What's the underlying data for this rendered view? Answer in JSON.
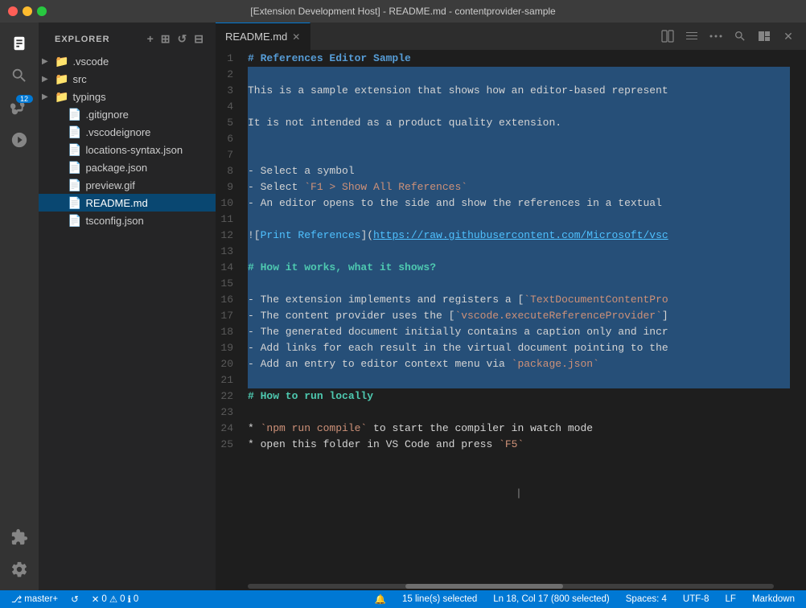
{
  "titlebar": {
    "title": "[Extension Development Host] - README.md - contentprovider-sample"
  },
  "activity_bar": {
    "icons": [
      {
        "name": "files-icon",
        "symbol": "⧉",
        "active": true,
        "badge": false
      },
      {
        "name": "search-icon",
        "symbol": "🔍",
        "active": false,
        "badge": false
      },
      {
        "name": "git-icon",
        "symbol": "⎇",
        "active": false,
        "badge": true,
        "badge_count": "12"
      },
      {
        "name": "debug-icon",
        "symbol": "⬤",
        "active": false,
        "badge": false
      }
    ],
    "bottom_icons": [
      {
        "name": "extensions-icon",
        "symbol": "⊞"
      },
      {
        "name": "settings-icon",
        "symbol": "⚙"
      }
    ]
  },
  "sidebar": {
    "header": "Explorer",
    "toolbar_icons": [
      "new-file",
      "new-folder",
      "refresh",
      "collapse"
    ],
    "files": [
      {
        "label": ".vscode",
        "type": "dir",
        "indent": 0,
        "expanded": false
      },
      {
        "label": "src",
        "type": "dir",
        "indent": 0,
        "expanded": false
      },
      {
        "label": "typings",
        "type": "dir",
        "indent": 0,
        "expanded": false
      },
      {
        "label": ".gitignore",
        "type": "file",
        "indent": 1
      },
      {
        "label": ".vscodeignore",
        "type": "file",
        "indent": 1
      },
      {
        "label": "locations-syntax.json",
        "type": "file",
        "indent": 1
      },
      {
        "label": "package.json",
        "type": "file",
        "indent": 1
      },
      {
        "label": "preview.gif",
        "type": "file",
        "indent": 1
      },
      {
        "label": "README.md",
        "type": "file",
        "indent": 1,
        "selected": true
      },
      {
        "label": "tsconfig.json",
        "type": "file",
        "indent": 1
      }
    ]
  },
  "editor": {
    "tab_label": "README.md",
    "lines": [
      {
        "num": 1,
        "content": "# References Editor Sample",
        "type": "h1"
      },
      {
        "num": 2,
        "content": "",
        "type": "empty"
      },
      {
        "num": 3,
        "content": "This is a sample extension that shows how an editor-based represent",
        "type": "text-selected"
      },
      {
        "num": 4,
        "content": "",
        "type": "selected"
      },
      {
        "num": 5,
        "content": "It is not intended as a product quality extension.",
        "type": "text-selected"
      },
      {
        "num": 6,
        "content": "",
        "type": "selected"
      },
      {
        "num": 7,
        "content": "",
        "type": "selected"
      },
      {
        "num": 8,
        "content": "- Select a symbol",
        "type": "text-selected"
      },
      {
        "num": 9,
        "content": "- Select `F1 > Show All References`",
        "type": "text-selected"
      },
      {
        "num": 10,
        "content": "- An editor opens to the side and show the references in a textual",
        "type": "text-selected"
      },
      {
        "num": 11,
        "content": "",
        "type": "selected"
      },
      {
        "num": 12,
        "content": "![Print References](https://raw.githubusercontent.com/Microsoft/vsc",
        "type": "text-selected"
      },
      {
        "num": 13,
        "content": "",
        "type": "selected"
      },
      {
        "num": 14,
        "content": "# How it works, what it shows?",
        "type": "h2-selected"
      },
      {
        "num": 15,
        "content": "",
        "type": "selected"
      },
      {
        "num": 16,
        "content": "- The extension implements and registers a [`TextDocumentContentPro",
        "type": "text-selected"
      },
      {
        "num": 17,
        "content": "- The content provider uses the [`vscode.executeReferenceProvider`]",
        "type": "text-selected"
      },
      {
        "num": 18,
        "content": "- The generated document initially contains a caption only and incr",
        "type": "text-selected"
      },
      {
        "num": 19,
        "content": "- Add links for each result in the virtual document pointing to the",
        "type": "text-selected"
      },
      {
        "num": 20,
        "content": "- Add an entry to editor context menu via `package.json`",
        "type": "text-selected"
      },
      {
        "num": 21,
        "content": "",
        "type": "selected"
      },
      {
        "num": 22,
        "content": "# How to run locally",
        "type": "h3"
      },
      {
        "num": 23,
        "content": "",
        "type": "empty"
      },
      {
        "num": 24,
        "content": "* `npm run compile` to start the compiler in watch mode",
        "type": "text"
      },
      {
        "num": 25,
        "content": "* open this folder in VS Code and press `F5`",
        "type": "text"
      }
    ]
  },
  "status_bar": {
    "branch": "master+",
    "sync_icon": "↺",
    "errors": "0",
    "warnings": "0",
    "info": "0",
    "selection_info": "15 line(s) selected",
    "position": "Ln 18, Col 17 (800 selected)",
    "spaces": "Spaces: 4",
    "encoding": "UTF-8",
    "line_ending": "LF",
    "language": "Markdown",
    "bell_icon": "🔔",
    "notification_icon": "🔔"
  }
}
